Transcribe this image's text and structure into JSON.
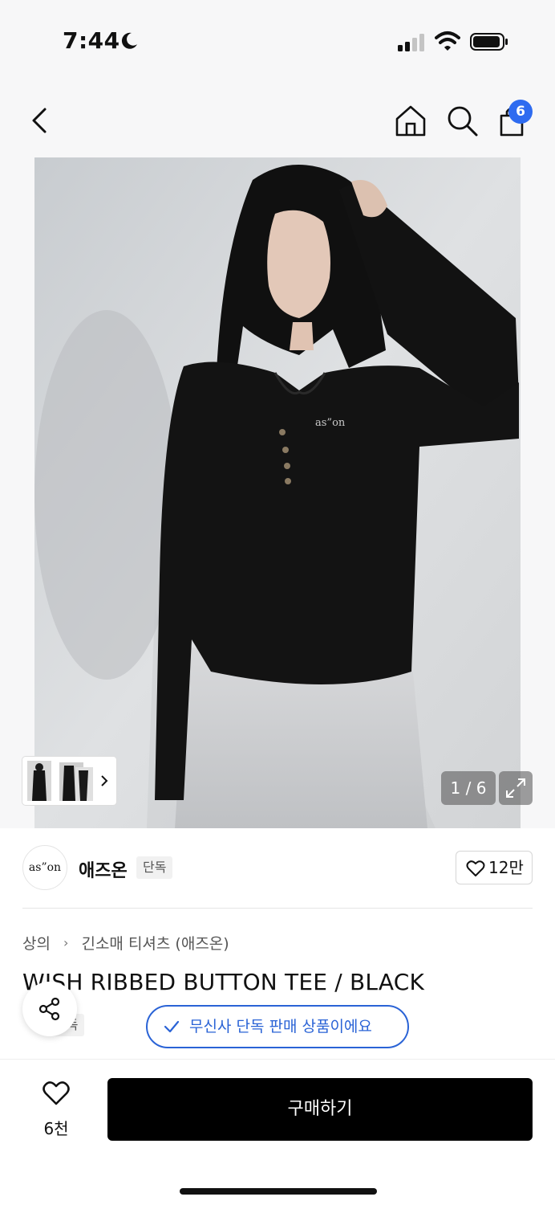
{
  "status_bar": {
    "time": "7:44"
  },
  "header": {
    "cart_count": "6"
  },
  "gallery": {
    "counter": "1 / 6"
  },
  "brand": {
    "logo_text": "as”on",
    "name": "애즈온",
    "badge": "단독",
    "likes": "12만"
  },
  "breadcrumb": {
    "category": "상의",
    "subcategory": "긴소매 티셔츠 (애즈온)"
  },
  "product": {
    "title": "WISH RIBBED BUTTON TEE / BLACK",
    "badge": "단독",
    "exclusive_notice": "무신사 단독 판매 상품이에요"
  },
  "bottom_bar": {
    "wish_count": "6천",
    "buy_label": "구매하기"
  },
  "colors": {
    "accent_blue": "#2a63d6",
    "badge_blue": "#2e6bf0",
    "buy_button": "#000000"
  }
}
